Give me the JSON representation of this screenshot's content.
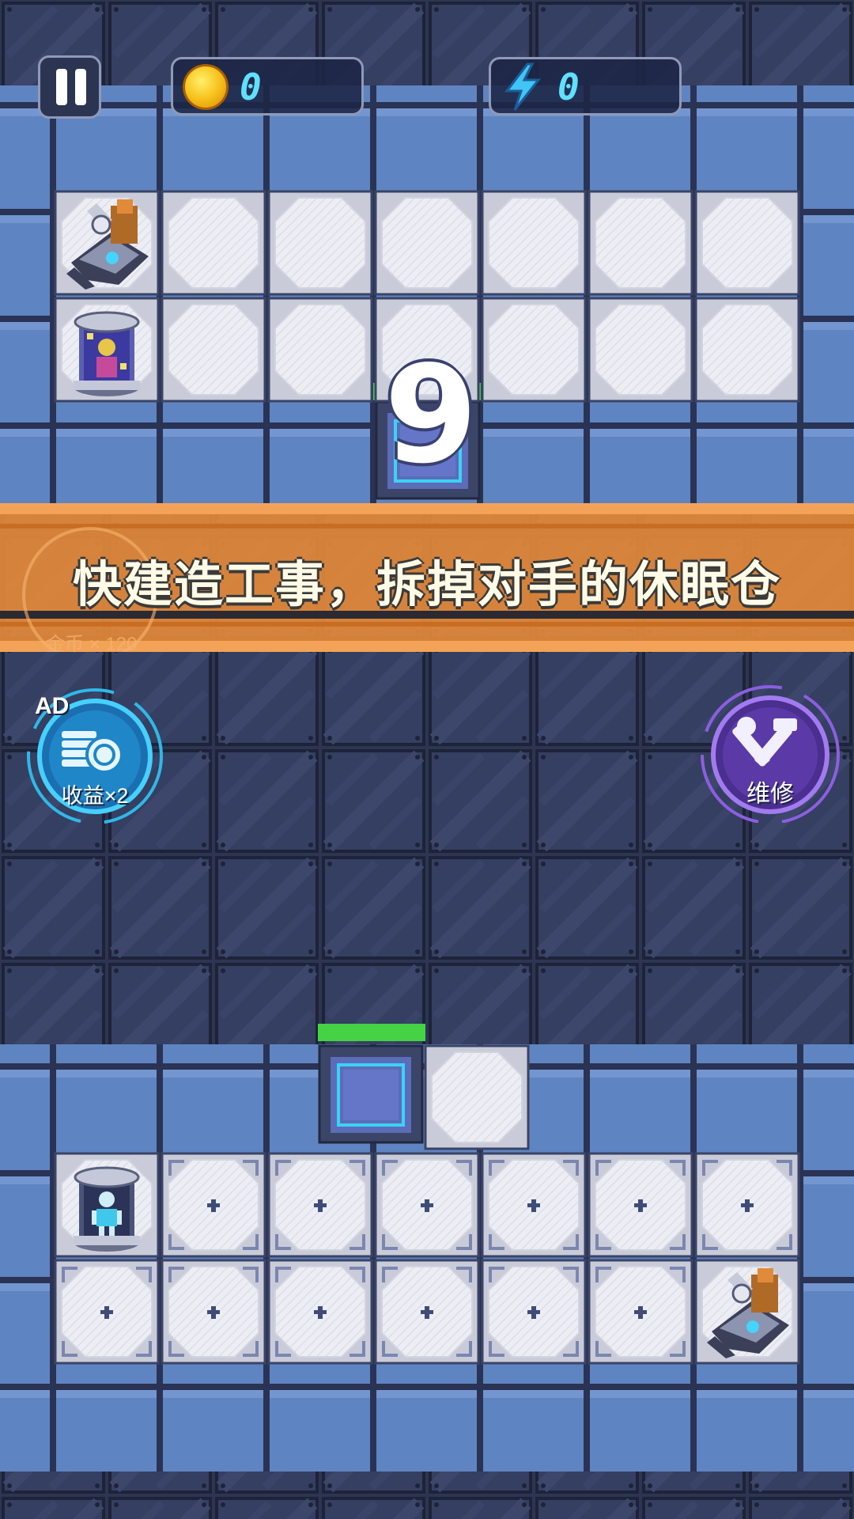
{
  "hud": {
    "coins": "0",
    "energy": "0",
    "coin_icon": "gold-coin-icon",
    "energy_icon": "lightning-bolt-icon",
    "pause_icon": "pause-icon"
  },
  "countdown": "9",
  "banner": {
    "text": "快建造工事，拆掉对手的休眠仓",
    "faint_text": "金币 × 120"
  },
  "buttons": {
    "ad_badge": "AD",
    "double_income": "收益×2",
    "repair": "维修"
  },
  "colors": {
    "floor_blue": "#5f84c2",
    "metal_dark": "#2e3654",
    "tile_white": "#e6e8f0",
    "banner_orange": "#e08a3a",
    "health_green": "#47d448",
    "accent_cyan": "#35c8f0",
    "accent_purple": "#8a5ad8"
  },
  "enemy_grid": {
    "rows": [
      [
        "turret",
        "empty",
        "empty",
        "empty",
        "empty",
        "empty",
        "empty"
      ],
      [
        "pod-purple",
        "empty",
        "empty",
        "empty",
        "empty",
        "empty",
        "empty"
      ]
    ]
  },
  "player_grid": {
    "rows": [
      [
        "pod-cyan",
        "plus",
        "plus",
        "plus",
        "plus",
        "plus",
        "plus"
      ],
      [
        "plus",
        "plus",
        "plus",
        "plus",
        "plus",
        "plus",
        "turret"
      ]
    ]
  }
}
